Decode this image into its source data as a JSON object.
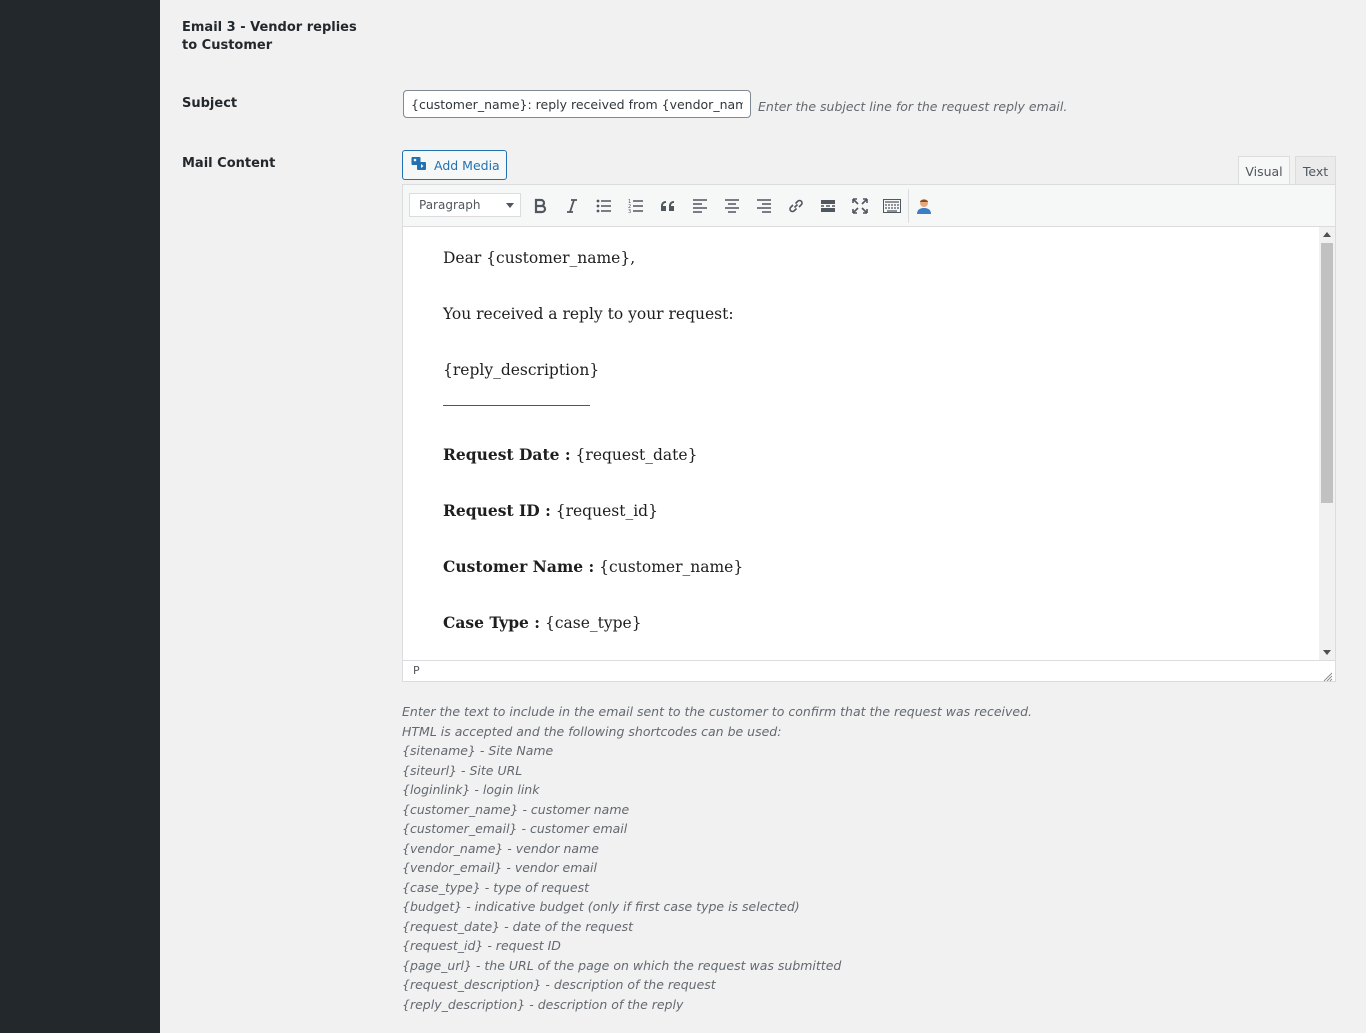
{
  "section": {
    "title": "Email 3 - Vendor replies to Customer"
  },
  "subject": {
    "label": "Subject",
    "value": "{customer_name}: reply received from {vendor_name}",
    "description": "Enter the subject line for the request reply email."
  },
  "mail_content": {
    "label": "Mail Content",
    "add_media_label": "Add Media",
    "tabs": {
      "visual": "Visual",
      "text": "Text"
    },
    "format_select": "Paragraph",
    "toolbar_icons": [
      "bold-icon",
      "italic-icon",
      "bullet-list-icon",
      "numbered-list-icon",
      "blockquote-icon",
      "align-left-icon",
      "align-center-icon",
      "align-right-icon",
      "link-icon",
      "read-more-icon",
      "fullscreen-icon",
      "toolbar-toggle-icon",
      "user-shortcode-icon"
    ],
    "body": {
      "greeting": "Dear {customer_name},",
      "intro": "You received a reply to your request:",
      "reply": "{reply_description}",
      "fields": [
        {
          "label": "Request Date :",
          "value": " {request_date}"
        },
        {
          "label": "Request ID :",
          "value": " {request_id}"
        },
        {
          "label": "Customer Name :",
          "value": " {customer_name}"
        },
        {
          "label": "Case Type :",
          "value": " {case_type}"
        }
      ]
    },
    "status_path": "P"
  },
  "help": {
    "lines": [
      "Enter the text to include in the email sent to the customer to confirm that the request was received.",
      "HTML is accepted and the following shortcodes can be used:",
      "{sitename} - Site Name",
      "{siteurl} - Site URL",
      "{loginlink} - login link",
      "{customer_name} - customer name",
      "{customer_email} - customer email",
      "{vendor_name} - vendor name",
      "{vendor_email} - vendor email",
      "{case_type} - type of request",
      "{budget} - indicative budget (only if first case type is selected)",
      "{request_date} - date of the request",
      "{request_id} - request ID",
      "{page_url} - the URL of the page on which the request was submitted",
      "{request_description} - description of the request",
      "{reply_description} - description of the reply"
    ]
  },
  "colors": {
    "sidebar": "#23282d",
    "background": "#f1f1f1",
    "accent": "#2271b1"
  }
}
